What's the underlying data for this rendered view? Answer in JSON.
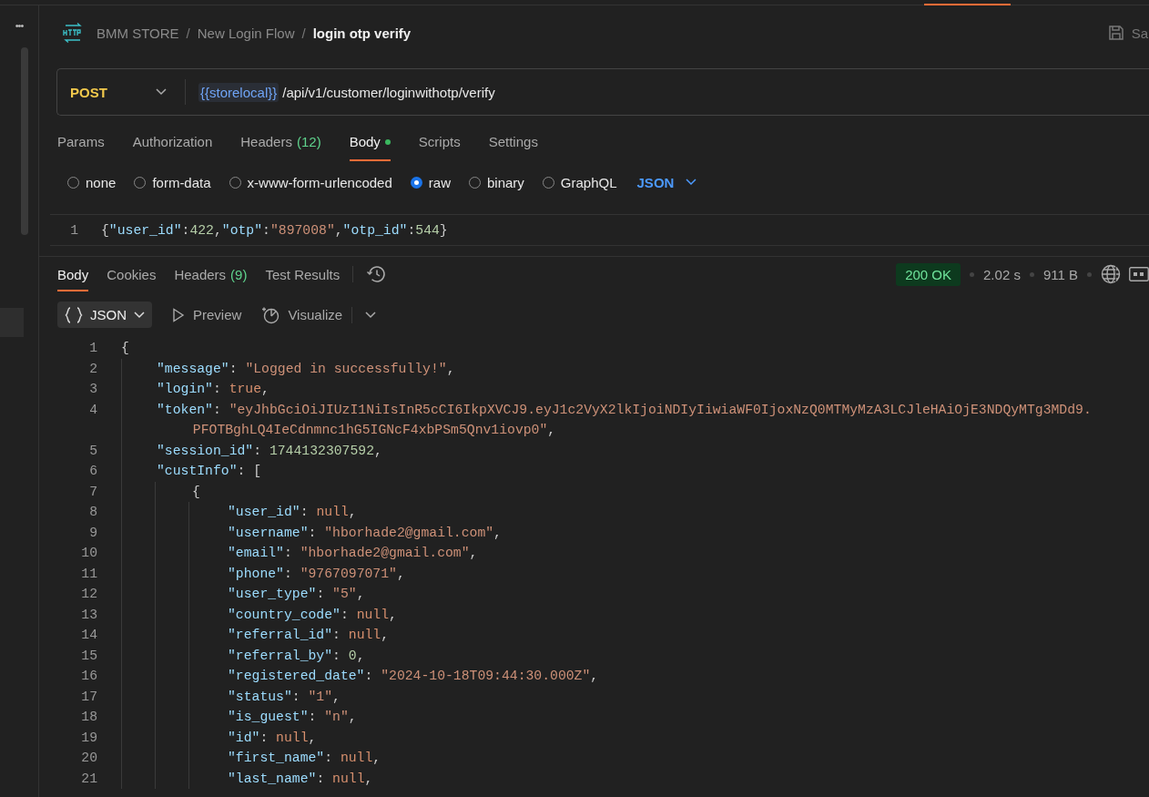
{
  "sidebar": {
    "more_label": "•••"
  },
  "breadcrumb": {
    "items": [
      "BMM STORE",
      "New Login Flow",
      "login otp verify"
    ],
    "separator": "/",
    "save_label": "Sa"
  },
  "request": {
    "method": "POST",
    "variable": "{{storelocal}}",
    "path": "/api/v1/customer/loginwithotp/verify",
    "tabs": [
      {
        "label": "Params",
        "selected": false
      },
      {
        "label": "Authorization",
        "selected": false
      },
      {
        "label": "Headers",
        "count": "(12)",
        "selected": false
      },
      {
        "label": "Body",
        "dot": true,
        "selected": true
      },
      {
        "label": "Scripts",
        "selected": false
      },
      {
        "label": "Settings",
        "selected": false
      }
    ],
    "body_types": [
      {
        "label": "none",
        "selected": false
      },
      {
        "label": "form-data",
        "selected": false
      },
      {
        "label": "x-www-form-urlencoded",
        "selected": false
      },
      {
        "label": "raw",
        "selected": true
      },
      {
        "label": "binary",
        "selected": false
      },
      {
        "label": "GraphQL",
        "selected": false
      }
    ],
    "language": "JSON",
    "body_lines": [
      {
        "number": "1",
        "tokens": [
          {
            "kind": "punct",
            "text": "{"
          },
          {
            "kind": "key",
            "text": "\"user_id\""
          },
          {
            "kind": "punct",
            "text": ":"
          },
          {
            "kind": "num",
            "text": "422"
          },
          {
            "kind": "punct",
            "text": ","
          },
          {
            "kind": "key",
            "text": "\"otp\""
          },
          {
            "kind": "punct",
            "text": ":"
          },
          {
            "kind": "str",
            "text": "\"897008\""
          },
          {
            "kind": "punct",
            "text": ","
          },
          {
            "kind": "key",
            "text": "\"otp_id\""
          },
          {
            "kind": "punct",
            "text": ":"
          },
          {
            "kind": "num",
            "text": "544"
          },
          {
            "kind": "punct",
            "text": "}"
          }
        ]
      }
    ]
  },
  "response": {
    "tabs": [
      {
        "label": "Body",
        "selected": true
      },
      {
        "label": "Cookies",
        "selected": false
      },
      {
        "label": "Headers",
        "count": "(9)",
        "selected": false
      },
      {
        "label": "Test Results",
        "selected": false
      }
    ],
    "status": "200 OK",
    "time": "2.02 s",
    "size": "911 B",
    "view_modes": [
      {
        "label": "JSON",
        "kind": "format",
        "selected": true
      },
      {
        "label": "Preview",
        "kind": "preview",
        "selected": false
      },
      {
        "label": "Visualize",
        "kind": "visualize",
        "selected": false
      }
    ],
    "lines": [
      {
        "number": "1",
        "tokens": [
          {
            "kind": "punct",
            "text": "{"
          }
        ],
        "children": [
          {
            "number": "2",
            "tokens": [
              {
                "kind": "key",
                "text": "\"message\""
              },
              {
                "kind": "punct",
                "text": ": "
              },
              {
                "kind": "str",
                "text": "\"Logged in successfully!\""
              },
              {
                "kind": "punct",
                "text": ","
              }
            ]
          },
          {
            "number": "3",
            "tokens": [
              {
                "kind": "key",
                "text": "\"login\""
              },
              {
                "kind": "punct",
                "text": ": "
              },
              {
                "kind": "kw",
                "text": "true"
              },
              {
                "kind": "punct",
                "text": ","
              }
            ]
          },
          {
            "number": "4",
            "tokens": [
              {
                "kind": "key",
                "text": "\"token\""
              },
              {
                "kind": "punct",
                "text": ": "
              },
              {
                "kind": "str",
                "text": "\"eyJhbGciOiJIUzI1NiIsInR5cCI6IkpXVCJ9.eyJ1c2VyX2lkIjoiNDIyIiwiaWF0IjoxNzQ0MTMyMzA3LCJleHAiOjE3NDQyMTg3MDd9.PFOTBghLQ4IeCdnmnc1hG5IGNcF4xbPSm5Qnv1iovp0\""
              },
              {
                "kind": "punct",
                "text": ","
              }
            ]
          },
          {
            "number": "5",
            "tokens": [
              {
                "kind": "key",
                "text": "\"session_id\""
              },
              {
                "kind": "punct",
                "text": ": "
              },
              {
                "kind": "num",
                "text": "1744132307592"
              },
              {
                "kind": "punct",
                "text": ","
              }
            ]
          },
          {
            "number": "6",
            "tokens": [
              {
                "kind": "key",
                "text": "\"custInfo\""
              },
              {
                "kind": "punct",
                "text": ": ["
              }
            ],
            "children": [
              {
                "number": "7",
                "tokens": [
                  {
                    "kind": "punct",
                    "text": "{"
                  }
                ],
                "children": [
                  {
                    "number": "8",
                    "tokens": [
                      {
                        "kind": "key",
                        "text": "\"user_id\""
                      },
                      {
                        "kind": "punct",
                        "text": ": "
                      },
                      {
                        "kind": "kw",
                        "text": "null"
                      },
                      {
                        "kind": "punct",
                        "text": ","
                      }
                    ]
                  },
                  {
                    "number": "9",
                    "tokens": [
                      {
                        "kind": "key",
                        "text": "\"username\""
                      },
                      {
                        "kind": "punct",
                        "text": ": "
                      },
                      {
                        "kind": "str",
                        "text": "\"hborhade2@gmail.com\""
                      },
                      {
                        "kind": "punct",
                        "text": ","
                      }
                    ]
                  },
                  {
                    "number": "10",
                    "tokens": [
                      {
                        "kind": "key",
                        "text": "\"email\""
                      },
                      {
                        "kind": "punct",
                        "text": ": "
                      },
                      {
                        "kind": "str",
                        "text": "\"hborhade2@gmail.com\""
                      },
                      {
                        "kind": "punct",
                        "text": ","
                      }
                    ]
                  },
                  {
                    "number": "11",
                    "tokens": [
                      {
                        "kind": "key",
                        "text": "\"phone\""
                      },
                      {
                        "kind": "punct",
                        "text": ": "
                      },
                      {
                        "kind": "str",
                        "text": "\"9767097071\""
                      },
                      {
                        "kind": "punct",
                        "text": ","
                      }
                    ]
                  },
                  {
                    "number": "12",
                    "tokens": [
                      {
                        "kind": "key",
                        "text": "\"user_type\""
                      },
                      {
                        "kind": "punct",
                        "text": ": "
                      },
                      {
                        "kind": "str",
                        "text": "\"5\""
                      },
                      {
                        "kind": "punct",
                        "text": ","
                      }
                    ]
                  },
                  {
                    "number": "13",
                    "tokens": [
                      {
                        "kind": "key",
                        "text": "\"country_code\""
                      },
                      {
                        "kind": "punct",
                        "text": ": "
                      },
                      {
                        "kind": "kw",
                        "text": "null"
                      },
                      {
                        "kind": "punct",
                        "text": ","
                      }
                    ]
                  },
                  {
                    "number": "14",
                    "tokens": [
                      {
                        "kind": "key",
                        "text": "\"referral_id\""
                      },
                      {
                        "kind": "punct",
                        "text": ": "
                      },
                      {
                        "kind": "kw",
                        "text": "null"
                      },
                      {
                        "kind": "punct",
                        "text": ","
                      }
                    ]
                  },
                  {
                    "number": "15",
                    "tokens": [
                      {
                        "kind": "key",
                        "text": "\"referral_by\""
                      },
                      {
                        "kind": "punct",
                        "text": ": "
                      },
                      {
                        "kind": "num",
                        "text": "0"
                      },
                      {
                        "kind": "punct",
                        "text": ","
                      }
                    ]
                  },
                  {
                    "number": "16",
                    "tokens": [
                      {
                        "kind": "key",
                        "text": "\"registered_date\""
                      },
                      {
                        "kind": "punct",
                        "text": ": "
                      },
                      {
                        "kind": "str",
                        "text": "\"2024-10-18T09:44:30.000Z\""
                      },
                      {
                        "kind": "punct",
                        "text": ","
                      }
                    ]
                  },
                  {
                    "number": "17",
                    "tokens": [
                      {
                        "kind": "key",
                        "text": "\"status\""
                      },
                      {
                        "kind": "punct",
                        "text": ": "
                      },
                      {
                        "kind": "str",
                        "text": "\"1\""
                      },
                      {
                        "kind": "punct",
                        "text": ","
                      }
                    ]
                  },
                  {
                    "number": "18",
                    "tokens": [
                      {
                        "kind": "key",
                        "text": "\"is_guest\""
                      },
                      {
                        "kind": "punct",
                        "text": ": "
                      },
                      {
                        "kind": "str",
                        "text": "\"n\""
                      },
                      {
                        "kind": "punct",
                        "text": ","
                      }
                    ]
                  },
                  {
                    "number": "19",
                    "tokens": [
                      {
                        "kind": "key",
                        "text": "\"id\""
                      },
                      {
                        "kind": "punct",
                        "text": ": "
                      },
                      {
                        "kind": "kw",
                        "text": "null"
                      },
                      {
                        "kind": "punct",
                        "text": ","
                      }
                    ]
                  },
                  {
                    "number": "20",
                    "tokens": [
                      {
                        "kind": "key",
                        "text": "\"first_name\""
                      },
                      {
                        "kind": "punct",
                        "text": ": "
                      },
                      {
                        "kind": "kw",
                        "text": "null"
                      },
                      {
                        "kind": "punct",
                        "text": ","
                      }
                    ]
                  },
                  {
                    "number": "21",
                    "tokens": [
                      {
                        "kind": "key",
                        "text": "\"last_name\""
                      },
                      {
                        "kind": "punct",
                        "text": ": "
                      },
                      {
                        "kind": "kw",
                        "text": "null"
                      },
                      {
                        "kind": "punct",
                        "text": ","
                      }
                    ]
                  }
                ]
              }
            ]
          }
        ]
      }
    ]
  }
}
